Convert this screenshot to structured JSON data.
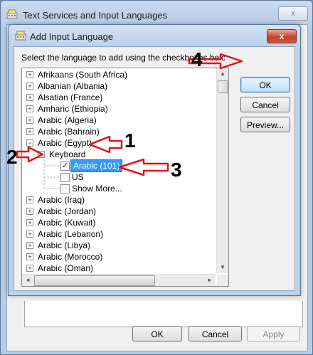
{
  "outer_window": {
    "title": "Text Services and Input Languages",
    "close_glyph": "x",
    "buttons": {
      "ok": "OK",
      "cancel": "Cancel",
      "apply": "Apply"
    }
  },
  "dialog": {
    "title": "Add Input Language",
    "close_glyph": "x",
    "instruction": "Select the language to add using the checkboxes below.",
    "buttons": {
      "ok": "OK",
      "cancel": "Cancel",
      "preview": "Preview..."
    }
  },
  "tree": [
    {
      "label": "Afrikaans (South Africa)",
      "expander": "+"
    },
    {
      "label": "Albanian (Albania)",
      "expander": "+"
    },
    {
      "label": "Alsatian (France)",
      "expander": "+"
    },
    {
      "label": "Amharic (Ethiopia)",
      "expander": "+"
    },
    {
      "label": "Arabic (Algeria)",
      "expander": "+"
    },
    {
      "label": "Arabic (Bahrain)",
      "expander": "+"
    },
    {
      "label": "Arabic (Egypt)",
      "expander": "−"
    },
    {
      "label": "Keyboard",
      "expander": "−"
    },
    {
      "label": "Arabic (101)",
      "checked": "✓"
    },
    {
      "label": "US",
      "checked": ""
    },
    {
      "label": "Show More...",
      "checked": ""
    },
    {
      "label": "Arabic (Iraq)",
      "expander": "+"
    },
    {
      "label": "Arabic (Jordan)",
      "expander": "+"
    },
    {
      "label": "Arabic (Kuwait)",
      "expander": "+"
    },
    {
      "label": "Arabic (Lebanon)",
      "expander": "+"
    },
    {
      "label": "Arabic (Libya)",
      "expander": "+"
    },
    {
      "label": "Arabic (Morocco)",
      "expander": "+"
    },
    {
      "label": "Arabic (Oman)",
      "expander": "+"
    }
  ],
  "scrollbar": {
    "up": "▲",
    "down": "▼",
    "left": "◄",
    "right": "►"
  },
  "annotations": {
    "step1": "1",
    "step2": "2",
    "step3": "3",
    "step4": "4",
    "arrow_color": "#e0141e"
  }
}
